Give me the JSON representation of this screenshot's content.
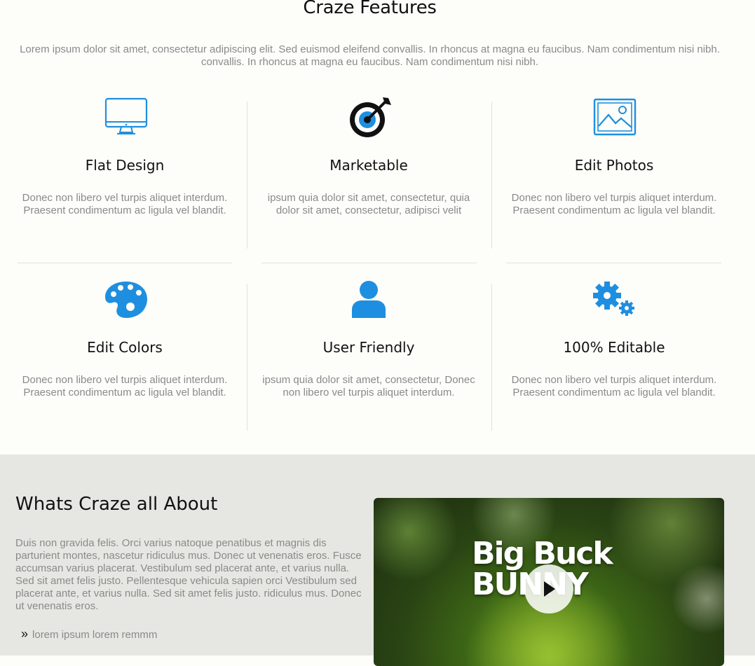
{
  "features_section": {
    "title": "Craze Features",
    "intro": "Lorem ipsum dolor sit amet, consectetur adipiscing elit. Sed euismod eleifend convallis. In rhoncus at magna eu faucibus. Nam condimentum nisi nibh. convallis. In rhoncus at magna eu faucibus. Nam condimentum nisi nibh.",
    "items": [
      {
        "title": "Flat Design",
        "text": "Donec non libero vel turpis aliquet interdum. Praesent condimentum ac ligula vel blandit.",
        "icon": "monitor-icon"
      },
      {
        "title": "Marketable",
        "text": "ipsum quia dolor sit amet, consectetur, quia dolor sit amet, consectetur, adipisci velit",
        "icon": "target-icon"
      },
      {
        "title": "Edit Photos",
        "text": "Donec non libero vel turpis aliquet interdum. Praesent condimentum ac ligula vel blandit.",
        "icon": "image-icon"
      },
      {
        "title": "Edit Colors",
        "text": "Donec non libero vel turpis aliquet interdum. Praesent condimentum ac ligula vel blandit.",
        "icon": "palette-icon"
      },
      {
        "title": "User Friendly",
        "text": "ipsum quia dolor sit amet, consectetur, Donec non libero vel turpis aliquet interdum.",
        "icon": "user-icon"
      },
      {
        "title": "100% Editable",
        "text": "Donec non libero vel turpis aliquet interdum. Praesent condimentum ac ligula vel blandit.",
        "icon": "gears-icon"
      }
    ]
  },
  "about_section": {
    "title": "Whats Craze all About",
    "text": "Duis non gravida felis. Orci varius natoque penatibus et magnis dis parturient montes, nascetur ridiculus mus. Donec ut venenatis eros. Fusce accumsan varius placerat. Vestibulum sed placerat ante, et varius nulla. Sed sit amet felis justo. Pellentesque vehicula sapien orci Vestibulum sed placerat ante, et varius nulla. Sed sit amet felis justo. ridiculus mus. Donec ut venenatis eros.",
    "bullet_mark": "»",
    "bullet": "lorem ipsum lorem remmm",
    "video_title": "Big Buck BUNNY"
  },
  "colors": {
    "accent": "#1e8fe0",
    "background": "#fdfdfa",
    "about_background": "#e6e6e2"
  }
}
